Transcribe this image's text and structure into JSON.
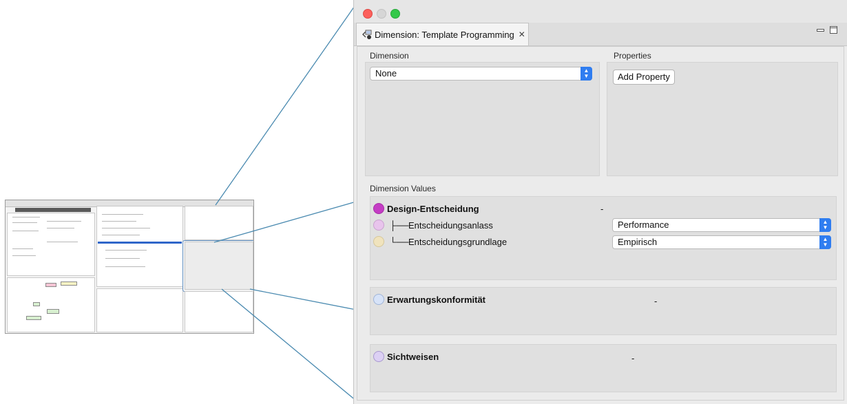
{
  "window": {
    "tab_title": "Dimension: Template Programming",
    "tab_icon": "dimension-icon",
    "close_icon": "close-icon",
    "minimize_icon": "minimize-icon",
    "maximize_icon": "maximize-icon",
    "traffic_lights": {
      "close": "#fc605c",
      "minimize": "#d6d6d6",
      "zoom": "#34c84a"
    }
  },
  "dimension": {
    "label": "Dimension",
    "selected": "None"
  },
  "properties": {
    "label": "Properties",
    "add_button": "Add Property"
  },
  "dimension_values": {
    "label": "Dimension Values",
    "groups": [
      {
        "name": "Design-Entscheidung",
        "value": "-",
        "color": "#c43dc4",
        "children": [
          {
            "prefix": "├──",
            "name": "Entscheidungsanlass",
            "selected": "Performance",
            "color": "#e8c4ec"
          },
          {
            "prefix": "└──",
            "name": "Entscheidungsgrundlage",
            "selected": "Empirisch",
            "color": "#f0e3bd"
          }
        ]
      },
      {
        "name": "Erwartungskonformität",
        "value": "-",
        "color": "#d7e3f8",
        "children": []
      },
      {
        "name": "Sichtweisen",
        "value": "-",
        "color": "#dcd0f4",
        "children": []
      }
    ]
  },
  "colors": {
    "accent": "#2f7df0",
    "connector": "#4a8ab0"
  }
}
